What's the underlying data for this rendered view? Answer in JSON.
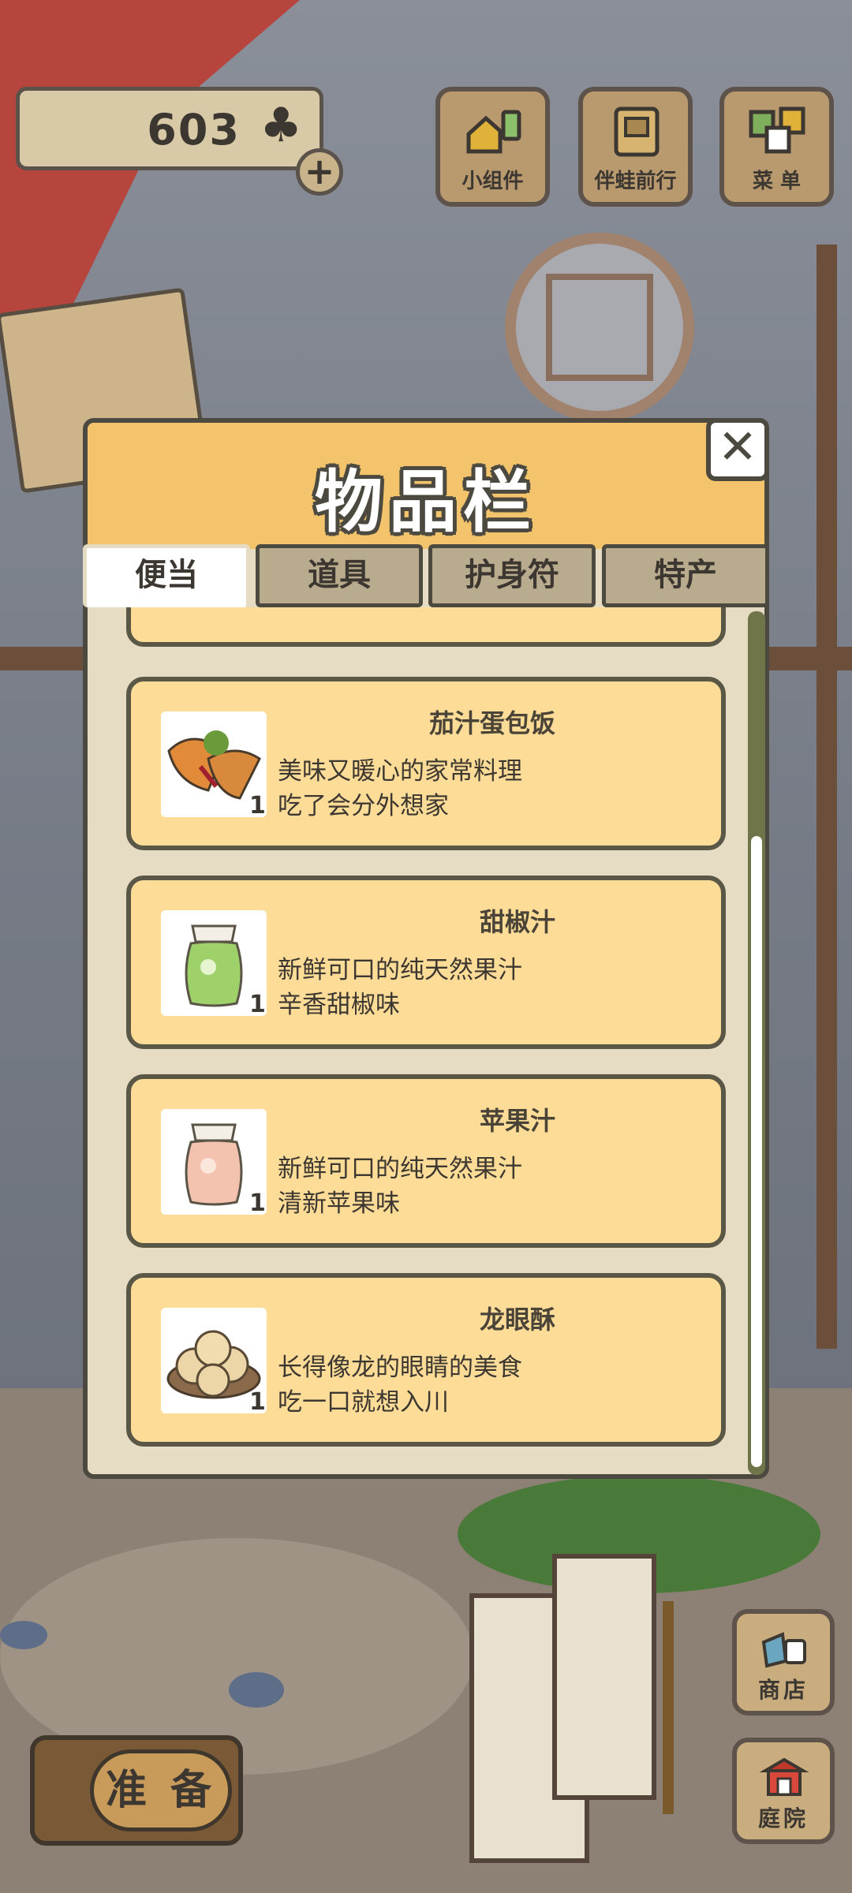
{
  "hud": {
    "clover_count": "603",
    "clover_icon": "clover-icon",
    "add_icon": "plus-icon"
  },
  "top_buttons": [
    {
      "label": "小组件",
      "icon": "widget-icon"
    },
    {
      "label": "伴蛙前行",
      "icon": "travel-book-icon"
    },
    {
      "label": "菜 单",
      "icon": "menu-cards-icon"
    }
  ],
  "panel": {
    "title": "物品栏",
    "close_icon": "close-icon",
    "tabs": [
      {
        "label": "便当",
        "active": true
      },
      {
        "label": "道具",
        "active": false
      },
      {
        "label": "护身符",
        "active": false
      },
      {
        "label": "特产",
        "active": false
      }
    ],
    "items": [
      {
        "name": "茄汁蛋包饭",
        "qty": "1",
        "desc1": "美味又暖心的家常料理",
        "desc2": "吃了会分外想家",
        "icon": "omelette-rice-icon"
      },
      {
        "name": "甜椒汁",
        "qty": "1",
        "desc1": "新鲜可口的纯天然果汁",
        "desc2": "辛香甜椒味",
        "icon": "green-juice-jar-icon"
      },
      {
        "name": "苹果汁",
        "qty": "1",
        "desc1": "新鲜可口的纯天然果汁",
        "desc2": "清新苹果味",
        "icon": "apple-juice-jar-icon"
      },
      {
        "name": "龙眼酥",
        "qty": "1",
        "desc1": "长得像龙的眼睛的美食",
        "desc2": "吃一口就想入川",
        "icon": "pastry-plate-icon"
      }
    ],
    "scroll_position": 0.27
  },
  "bottom": {
    "prepare_label": "准 备",
    "shop_label": "商店",
    "yard_label": "庭院"
  },
  "colors": {
    "panel_header": "#f3c46c",
    "card_bg": "#fddc97",
    "panel_bg": "#e6dcc4",
    "outline": "#4c4a40"
  }
}
